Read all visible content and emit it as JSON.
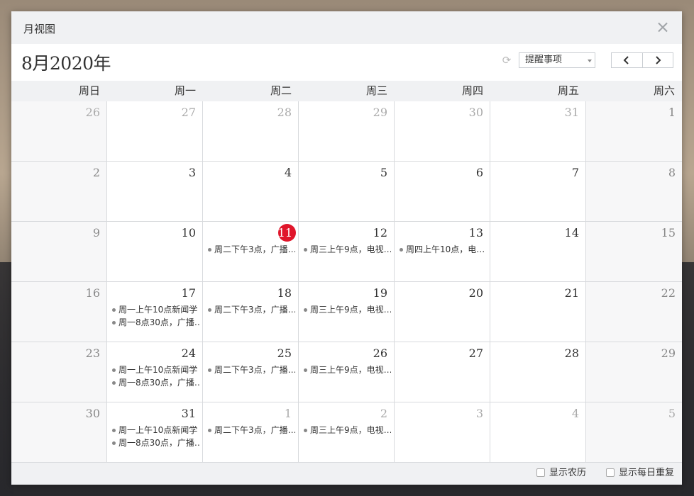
{
  "window": {
    "title": "月视图"
  },
  "header": {
    "month_title": "8月2020年",
    "filter_select": "提醒事项"
  },
  "weekdays": [
    "周日",
    "周一",
    "周二",
    "周三",
    "周四",
    "周五",
    "周六"
  ],
  "weeks": [
    [
      {
        "day": "26",
        "other": true
      },
      {
        "day": "27",
        "other": true
      },
      {
        "day": "28",
        "other": true
      },
      {
        "day": "29",
        "other": true
      },
      {
        "day": "30",
        "other": true
      },
      {
        "day": "31",
        "other": true
      },
      {
        "day": "1"
      }
    ],
    [
      {
        "day": "2"
      },
      {
        "day": "3"
      },
      {
        "day": "4"
      },
      {
        "day": "5"
      },
      {
        "day": "6"
      },
      {
        "day": "7"
      },
      {
        "day": "8"
      }
    ],
    [
      {
        "day": "9"
      },
      {
        "day": "10"
      },
      {
        "day": "11",
        "today": true,
        "events": [
          "周二下午3点，广播…"
        ]
      },
      {
        "day": "12",
        "events": [
          "周三上午9点，电视…"
        ]
      },
      {
        "day": "13",
        "events": [
          "周四上午10点，电…"
        ]
      },
      {
        "day": "14"
      },
      {
        "day": "15"
      }
    ],
    [
      {
        "day": "16"
      },
      {
        "day": "17",
        "events": [
          "周一上午10点新闻学",
          "周一8点30点，广播…"
        ]
      },
      {
        "day": "18",
        "events": [
          "周二下午3点，广播…"
        ]
      },
      {
        "day": "19",
        "events": [
          "周三上午9点，电视…"
        ]
      },
      {
        "day": "20"
      },
      {
        "day": "21"
      },
      {
        "day": "22"
      }
    ],
    [
      {
        "day": "23"
      },
      {
        "day": "24",
        "events": [
          "周一上午10点新闻学",
          "周一8点30点，广播…"
        ]
      },
      {
        "day": "25",
        "events": [
          "周二下午3点，广播…"
        ]
      },
      {
        "day": "26",
        "events": [
          "周三上午9点，电视…"
        ]
      },
      {
        "day": "27"
      },
      {
        "day": "28"
      },
      {
        "day": "29"
      }
    ],
    [
      {
        "day": "30"
      },
      {
        "day": "31",
        "events": [
          "周一上午10点新闻学",
          "周一8点30点，广播…"
        ]
      },
      {
        "day": "1",
        "other": true,
        "events": [
          "周二下午3点，广播…"
        ]
      },
      {
        "day": "2",
        "other": true,
        "events": [
          "周三上午9点，电视…"
        ]
      },
      {
        "day": "3",
        "other": true
      },
      {
        "day": "4",
        "other": true
      },
      {
        "day": "5",
        "other": true
      }
    ]
  ],
  "footer": {
    "show_lunar": "显示农历",
    "show_daily_repeat": "显示每日重复"
  },
  "colors": {
    "today": "#e0162b"
  }
}
